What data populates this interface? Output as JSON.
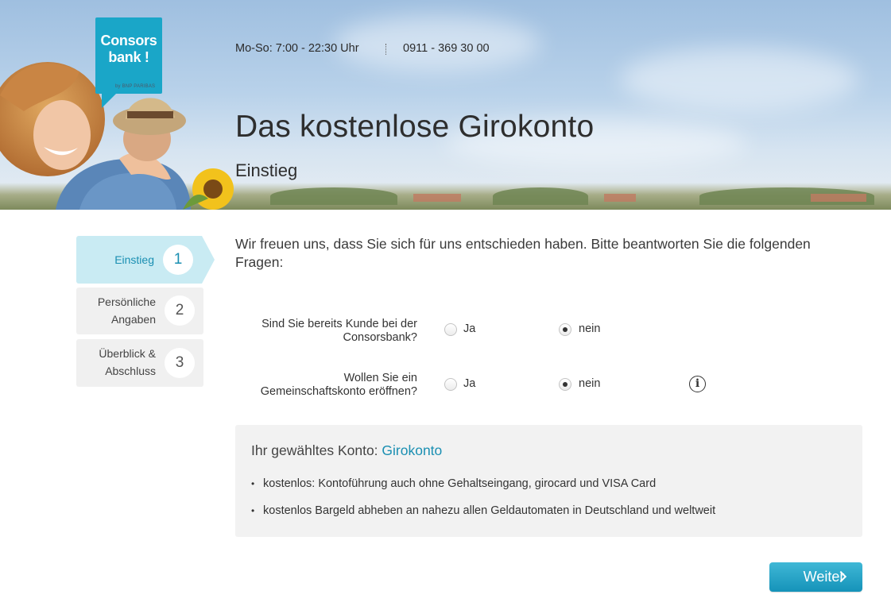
{
  "header": {
    "logo_text_line1": "Consors",
    "logo_text_line2": "bank !",
    "logo_subtext": "by BNP PARIBAS",
    "hours": "Mo-So: 7:00 - 22:30 Uhr",
    "phone": "0911 - 369 30 00",
    "title": "Das kostenlose Girokonto",
    "subtitle": "Einstieg"
  },
  "steps": [
    {
      "label": "Einstieg",
      "number": "1",
      "active": true
    },
    {
      "label_line1": "Persönliche",
      "label_line2": "Angaben",
      "number": "2",
      "active": false
    },
    {
      "label_line1": "Überblick &",
      "label_line2": "Abschluss",
      "number": "3",
      "active": false
    }
  ],
  "intro": "Wir freuen uns, dass Sie sich für uns entschieden haben. Bitte beantworten Sie die folgenden Fragen:",
  "questions": [
    {
      "label_line1": "Sind Sie bereits Kunde bei der",
      "label_line2": "Consorsbank?",
      "option_yes": "Ja",
      "option_no": "nein",
      "selected": "nein"
    },
    {
      "label_line1": "Wollen Sie ein",
      "label_line2": "Gemeinschaftskonto eröffnen?",
      "option_yes": "Ja",
      "option_no": "nein",
      "selected": "nein",
      "info_icon": "info-icon"
    }
  ],
  "account": {
    "prefix": "Ihr gewähltes Konto: ",
    "name": "Girokonto",
    "features": [
      "kostenlos: Kontoführung auch ohne Gehaltseingang, girocard und VISA Card",
      "kostenlos Bargeld abheben an nahezu allen Geldautomaten in Deutschland und weltweit"
    ]
  },
  "actions": {
    "next_label": "Weiter"
  },
  "colors": {
    "accent": "#1aa6c8",
    "link": "#1a8fb2",
    "active_step_bg": "#c9ebf3",
    "panel_bg": "#f2f2f2"
  }
}
